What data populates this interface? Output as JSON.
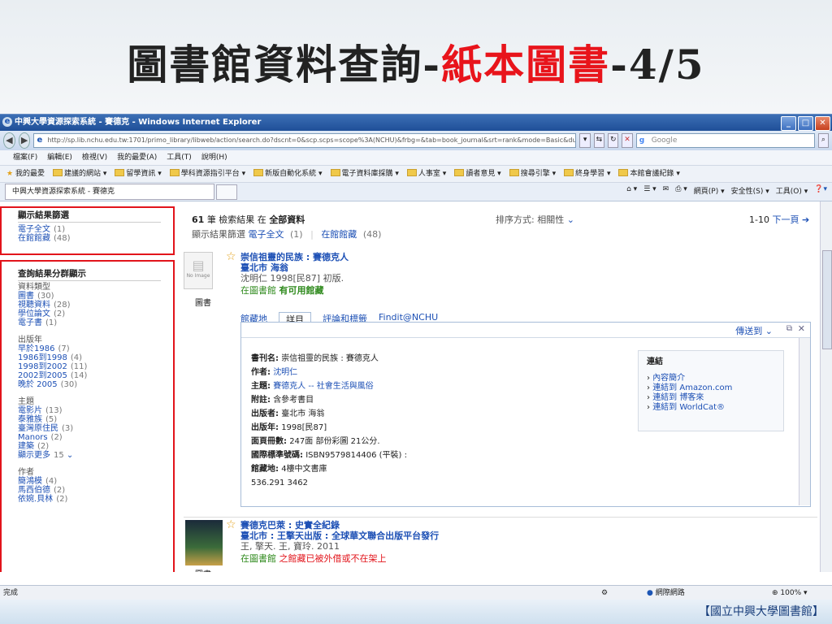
{
  "slide": {
    "title_main": "圖書館資料查詢-",
    "title_red": "紙本圖書",
    "title_suffix": "-4/5",
    "footer": "【國立中興大學圖書館】"
  },
  "window": {
    "title": "中興大學資源探索系統 - 賽德克 - Windows Internet Explorer",
    "url": "http://sp.lib.nchu.edu.tw:1701/primo_library/libweb/action/search.do?dscnt=0&scp.scps=scope%3A(NCHU)&frbg=&tab=book_journal&srt=rank&mode=Basic&du",
    "search_placeholder": "Google",
    "menu": [
      "檔案(F)",
      "編輯(E)",
      "檢視(V)",
      "我的最愛(A)",
      "工具(T)",
      "說明(H)"
    ],
    "favorites": [
      "我的最愛",
      "建議的網站 ▾",
      "留學資訊 ▾",
      "學科資源指引平台 ▾",
      "新版自動化系統 ▾",
      "電子資料庫採購 ▾",
      "人事室 ▾",
      "讀者意見 ▾",
      "搜尋引擎 ▾",
      "終身學習 ▾",
      "本館會議紀錄 ▾"
    ],
    "tab_label": "中興大學資源探索系統 - 賽德克",
    "tab_tools": [
      "網頁(P) ▾",
      "安全性(S) ▾",
      "工具(O) ▾"
    ],
    "status_left": "完成",
    "status_zone": "網際網路",
    "zoom": "100%"
  },
  "filters": {
    "heading": "顯示結果篩選",
    "items": [
      {
        "label": "電子全文",
        "count": "(1)"
      },
      {
        "label": "在館館藏",
        "count": "(48)"
      }
    ]
  },
  "facets": {
    "heading": "查詢結果分群顯示",
    "groups": [
      {
        "name": "資料類型",
        "items": [
          {
            "label": "圖書",
            "count": "(30)"
          },
          {
            "label": "視聽資料",
            "count": "(28)"
          },
          {
            "label": "學位論文",
            "count": "(2)"
          },
          {
            "label": "電子書",
            "count": "(1)"
          }
        ]
      },
      {
        "name": "出版年",
        "items": [
          {
            "label": "早於1986",
            "count": "(7)"
          },
          {
            "label": "1986到1998",
            "count": "(4)"
          },
          {
            "label": "1998到2002",
            "count": "(11)"
          },
          {
            "label": "2002到2005",
            "count": "(14)"
          },
          {
            "label": "晚於 2005",
            "count": "(30)"
          }
        ]
      },
      {
        "name": "主題",
        "items": [
          {
            "label": "電影片",
            "count": "(13)"
          },
          {
            "label": "泰雅族",
            "count": "(5)"
          },
          {
            "label": "臺灣原住民",
            "count": "(3)"
          },
          {
            "label": "Manors",
            "count": "(2)"
          },
          {
            "label": "建築",
            "count": "(2)"
          },
          {
            "label": "顯示更多",
            "count": "15"
          }
        ]
      },
      {
        "name": "作者",
        "items": [
          {
            "label": "簡鴻模",
            "count": "(4)"
          },
          {
            "label": "馬西伯德",
            "count": "(2)"
          },
          {
            "label": "依婉.貝林",
            "count": "(2)"
          }
        ]
      }
    ]
  },
  "results": {
    "count": "61",
    "summary_mid": "筆 檢索結果 在",
    "scope": "全部資料",
    "filter_line": "顯示結果篩選",
    "filter_full": "電子全文",
    "filter_full_count": "(1)",
    "filter_hold": "在館館藏",
    "filter_hold_count": "(48)",
    "sort_label": "排序方式:",
    "sort_value": "相關性",
    "range": "1-10",
    "next": "下一頁"
  },
  "item1": {
    "title": "崇信祖靈的民族 : 賽德克人",
    "publisher": "臺北市 海翁",
    "author_line": "沈明仁 1998[民87] 初版.",
    "avail_prefix": "在圖書館",
    "avail": "有可用館藏",
    "type": "圖書",
    "noimage": "No Image",
    "tabs": [
      "館藏地",
      "詳目",
      "評論和標籤",
      "Findit@NCHU"
    ],
    "send_to": "傳送到",
    "fields": [
      {
        "k": "書刊名:",
        "v": "崇信祖靈的民族 : 賽德克人"
      },
      {
        "k": "作者:",
        "v": "沈明仁"
      },
      {
        "k": "主題:",
        "v": "賽德克人 -- 社會生活與風俗"
      },
      {
        "k": "附註:",
        "v": "含參考書目"
      },
      {
        "k": "出版者:",
        "v": "臺北市 海翁"
      },
      {
        "k": "出版年:",
        "v": "1998[民87]"
      },
      {
        "k": "面頁冊數:",
        "v": "247面 部份彩圖 21公分."
      },
      {
        "k": "國際標準號碼:",
        "v": "ISBN9579814406 (平裝) :"
      },
      {
        "k": "館藏地:",
        "v": "4樓中文書庫"
      },
      {
        "k": "",
        "v": "536.291 3462"
      }
    ],
    "links_heading": "連結",
    "links": [
      "內容簡介",
      "連結到 Amazon.com",
      "連結到 博客來",
      "連結到 WorldCat®"
    ]
  },
  "item2": {
    "title": "賽德克巴萊 : 史實全紀錄",
    "publisher": "臺北市 : 王擎天出版 : 全球華文聯合出版平台發行",
    "author_line": "王, 擎天. 王, 寶玲. 2011",
    "avail_prefix": "在圖書館",
    "avail": "之館藏已被外借或不在架上",
    "type": "圖書"
  }
}
